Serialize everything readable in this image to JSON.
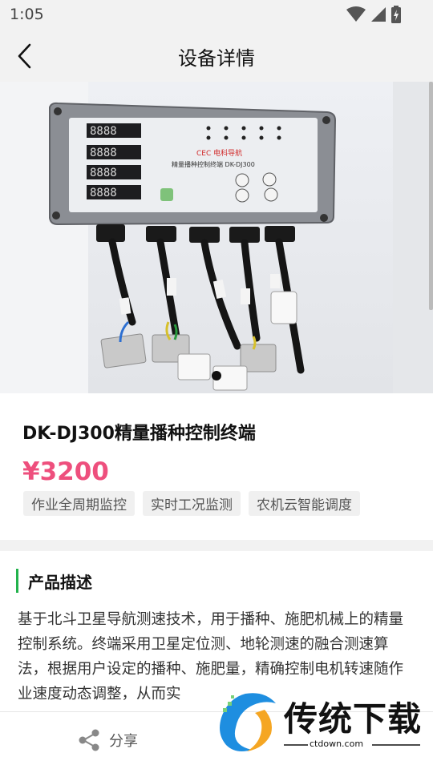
{
  "status_bar": {
    "time": "1:05"
  },
  "app_bar": {
    "title": "设备详情"
  },
  "carousel": {
    "image_alt": "DK-DJ300 device photo",
    "active_index": 0,
    "total": 1
  },
  "product": {
    "name": "DK-DJ300精量播种控制终端",
    "price": "¥3200",
    "tags": [
      "作业全周期监控",
      "实时工况监测",
      "农机云智能调度"
    ]
  },
  "description": {
    "title": "产品描述",
    "text": "基于北斗卫星导航测速技术，用于播种、施肥机械上的精量控制系统。终端采用卫星定位测、地轮测速的融合测速算法，根据用户设定的播种、施肥量，精确控制电机转速随作业速度动态调整，从而实"
  },
  "bottom_bar": {
    "share_label": "分享"
  },
  "watermark": {
    "brand": "传统下载",
    "url": "ctdown.com"
  },
  "device_panel": {
    "brand": "CEC 电科导航",
    "model": "精量播种控制终端 DK-DJ300",
    "displays": [
      "8888",
      "8888",
      "8888",
      "8888"
    ]
  }
}
